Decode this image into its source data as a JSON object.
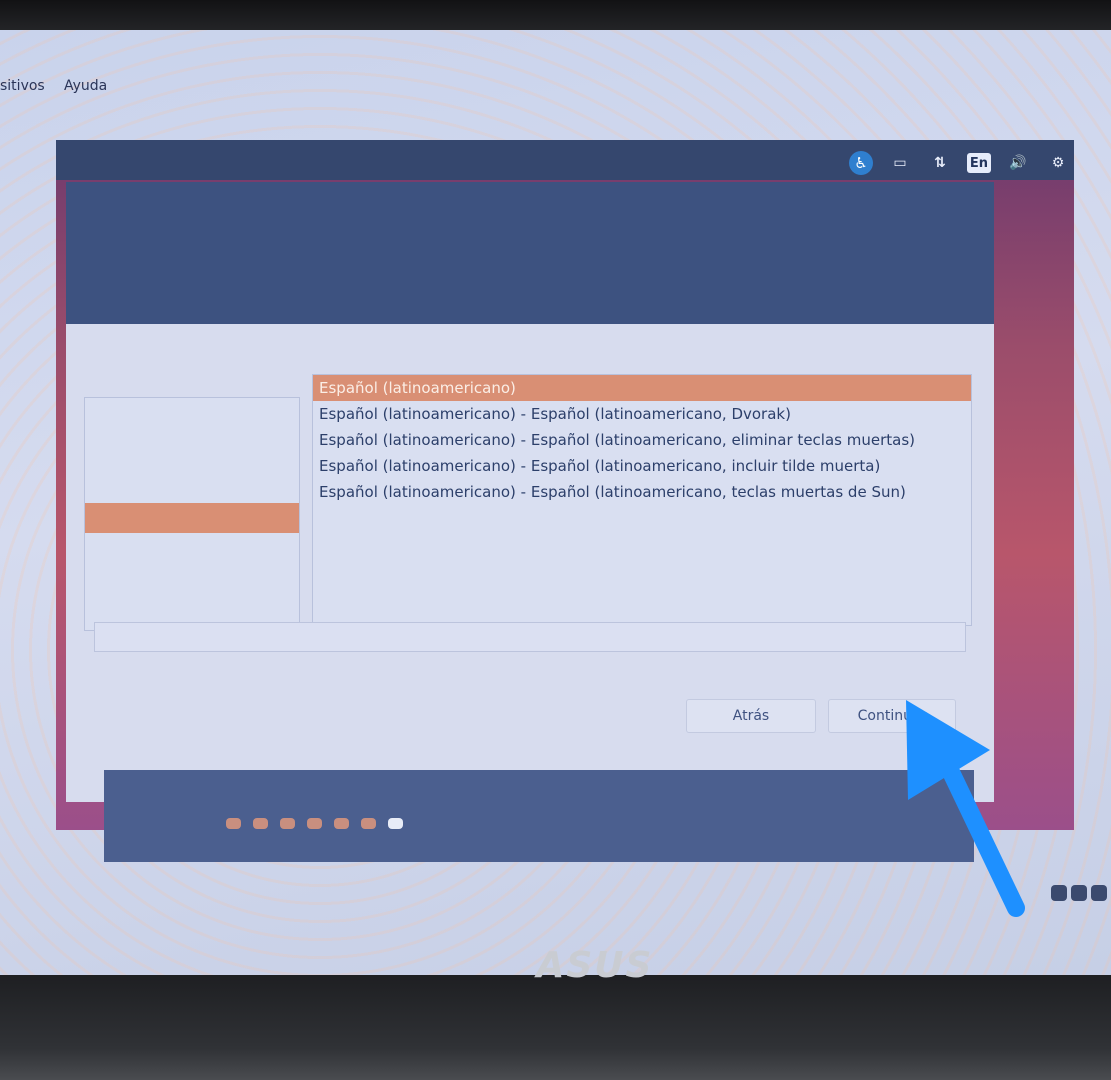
{
  "menubar": {
    "items": [
      "sitivos",
      "Ayuda"
    ]
  },
  "tray": {
    "accessibility_icon": "accessibility-icon",
    "battery_icon": "battery-icon",
    "network_icon": "network-transfer-icon",
    "keyboard_layout": "En",
    "volume_icon": "volume-icon",
    "settings_icon": "gear-icon"
  },
  "layout_variants": [
    "Español (latinoamericano)",
    "Español (latinoamericano) - Español (latinoamericano, Dvorak)",
    "Español (latinoamericano) - Español (latinoamericano, eliminar teclas muertas)",
    "Español (latinoamericano) - Español (latinoamericano, incluir tilde muerta)",
    "Español (latinoamericano) - Español (latinoamericano, teclas muertas de Sun)"
  ],
  "selected_variant_index": 0,
  "buttons": {
    "back": "Atrás",
    "continue": "Continuar"
  },
  "progress": {
    "steps": 7,
    "current": 7
  },
  "brand": "ASUS",
  "colors": {
    "selection": "#d98f74",
    "arrow": "#1e90ff"
  }
}
